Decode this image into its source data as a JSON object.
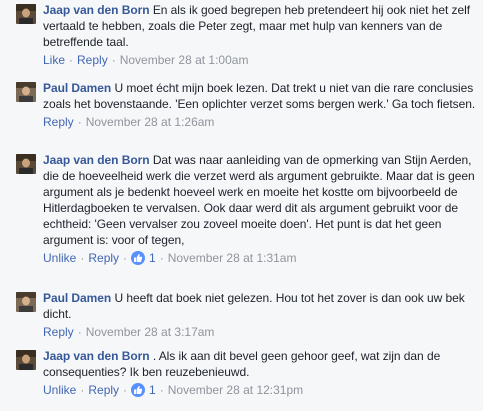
{
  "comments": [
    {
      "author": "Jaap van den Born",
      "text": "En als ik goed begrepen heb pretendeert hij ook niet het zelf vertaald te hebben, zoals die Peter zegt, maar met hulp van kenners van de betreffende taal.",
      "like_label": "Like",
      "reply_label": "Reply",
      "time": "November 28 at 1:00am",
      "separator": "·"
    },
    {
      "author": "Paul Damen",
      "text": "U moet écht mijn boek lezen. Dat trekt u niet van die rare conclusies zoals het bovenstaande. 'Een oplichter verzet soms bergen werk.' Ga toch fietsen.",
      "reply_label": "Reply",
      "time": "November 28 at 1:26am",
      "separator": "·"
    },
    {
      "author": "Jaap van den Born",
      "text": "Dat was naar aanleiding van de opmerking van Stijn Aerden, die de hoeveelheid werk die verzet werd als argument gebruikte. Maar dat is geen argument als je bedenkt hoeveel werk en moeite het kostte om bijvoorbeeld de Hitlerdagboeken te vervalsen. Ook daar werd dit als argument gebruikt voor de echtheid: 'Geen vervalser zou zoveel moeite doen'. Het punt is dat het geen argument is: voor of tegen,",
      "unlike_label": "Unlike",
      "reply_label": "Reply",
      "like_count": "1",
      "time": "November 28 at 1:31am",
      "separator": "·"
    },
    {
      "author": "Paul Damen",
      "text": "U heeft dat boek niet gelezen. Hou tot het zover is dan ook uw bek dicht.",
      "reply_label": "Reply",
      "time": "November 28 at 3:17am",
      "separator": "·"
    },
    {
      "author": "Jaap van den Born",
      "text": ". Als ik aan dit bevel geen gehoor geef, wat zijn dan de consequenties? Ik ben reuzebenieuwd.",
      "unlike_label": "Unlike",
      "reply_label": "Reply",
      "like_count": "1",
      "time": "November 28 at 12:31pm",
      "separator": "·"
    }
  ],
  "icons": {
    "like": "thumbs-up-icon",
    "avatar": "profile-photo"
  },
  "colors": {
    "author": "#365899",
    "link": "#4267b2",
    "meta": "#90949c",
    "text": "#1d2129",
    "background": "#f6f7f9",
    "like_badge": "#5890ff"
  }
}
